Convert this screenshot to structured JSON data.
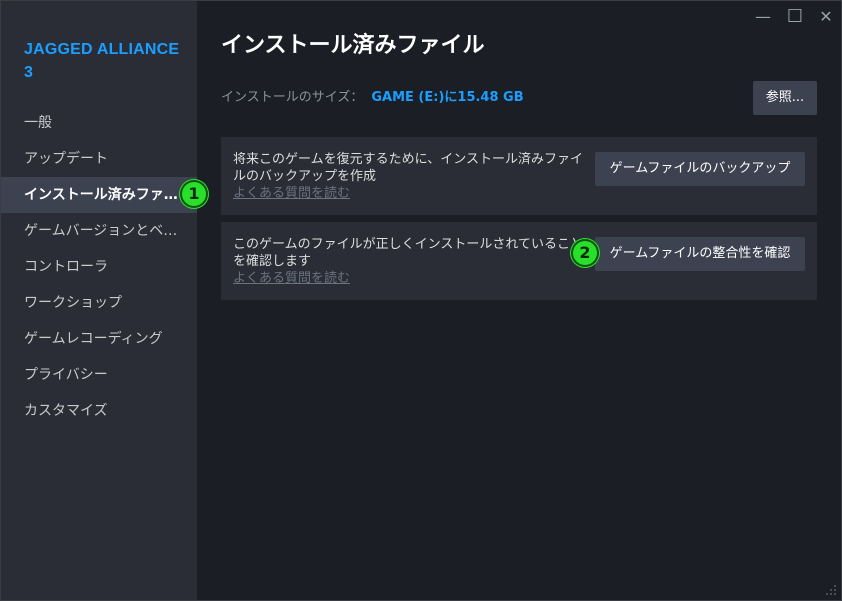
{
  "window": {
    "controls": {
      "minimize": "—",
      "maximize": "☐",
      "close": "✕"
    }
  },
  "sidebar": {
    "app_title": "JAGGED ALLIANCE 3",
    "items": [
      {
        "label": "一般"
      },
      {
        "label": "アップデート"
      },
      {
        "label": "インストール済みファ…"
      },
      {
        "label": "ゲームバージョンとベ…"
      },
      {
        "label": "コントローラ"
      },
      {
        "label": "ワークショップ"
      },
      {
        "label": "ゲームレコーディング"
      },
      {
        "label": "プライバシー"
      },
      {
        "label": "カスタマイズ"
      }
    ],
    "active_index": 2
  },
  "markers": {
    "one": "1",
    "two": "2"
  },
  "main": {
    "title": "インストール済みファイル",
    "install_size_label": "インストールのサイズ：",
    "install_size_value": "GAME (E:)に15.48 GB",
    "browse_label": "参照...",
    "panels": [
      {
        "description": "将来このゲームを復元するために、インストール済みファイルのバックアップを作成",
        "link": "よくある質問を読む",
        "button": "ゲームファイルのバックアップ"
      },
      {
        "description": "このゲームのファイルが正しくインストールされていることを確認します",
        "link": "よくある質問を読む",
        "button": "ゲームファイルの整合性を確認"
      }
    ]
  },
  "colors": {
    "accent": "#1a9fff",
    "background": "#1b1e24",
    "sidebar": "#2a2d35",
    "active_item": "#3d4250",
    "marker": "#28e02a"
  }
}
